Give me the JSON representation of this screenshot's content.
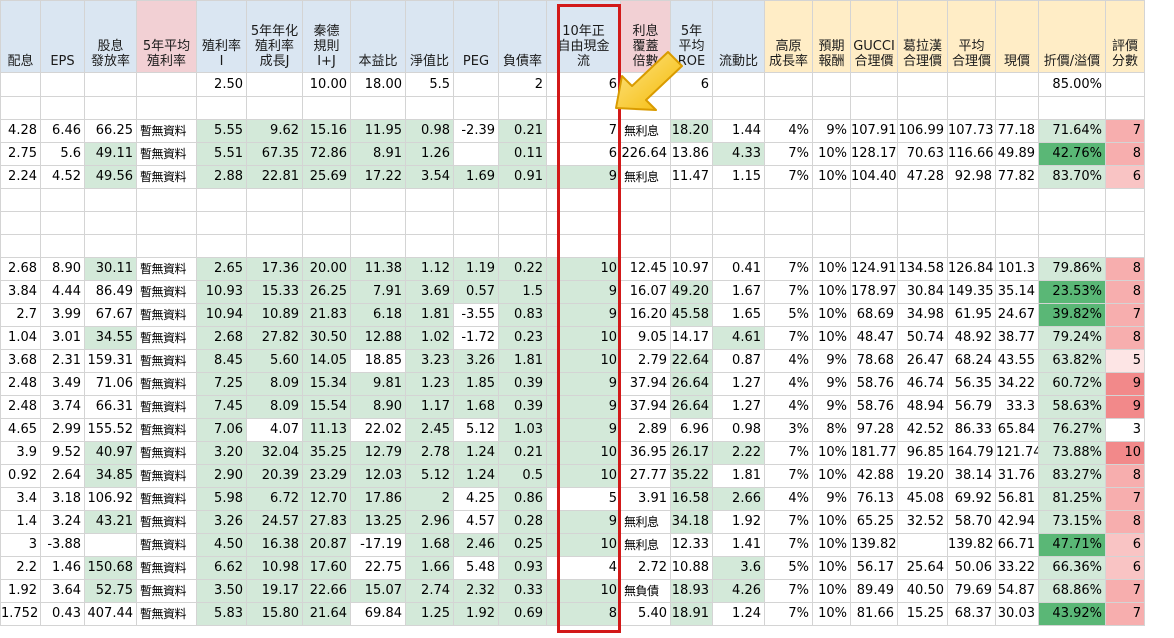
{
  "headers": [
    "配息",
    "EPS",
    "股息\n發放率",
    "5年平均\n殖利率",
    "殖利率\nI",
    "5年年化\n殖利率\n成長J",
    "秦德\n規則\nI+J",
    "本益比",
    "淨值比",
    "PEG",
    "負債率",
    "10年正\n自由現金\n流",
    "利息\n覆蓋\n倍數",
    "5年\n平均\nROE",
    "流動比",
    "高原\n成長率",
    "預期\n報酬",
    "GUCCI\n合理價",
    "葛拉漢\n合理價",
    "平均\n合理價",
    "現價",
    "折價/溢價",
    "評價\n分數"
  ],
  "header_color_classes": [
    "",
    "",
    "",
    "pink",
    "",
    "",
    "",
    "",
    "",
    "",
    "",
    "",
    "pink",
    "",
    "",
    "amber",
    "amber",
    "amber",
    "amber",
    "amber",
    "amber",
    "amber",
    "amber"
  ],
  "criteria_row": [
    "",
    "",
    "",
    "",
    "2.50",
    "",
    "10.00",
    "18.00",
    "5.5",
    "",
    "2",
    "6",
    "",
    "6",
    "",
    "",
    "",
    "",
    "",
    "",
    "",
    "85.00%",
    ""
  ],
  "rows": [
    {
      "type": "blank"
    },
    {
      "type": "data",
      "cells": [
        "4.28",
        "6.46",
        "66.25",
        "暫無資料",
        "5.55",
        "9.62",
        "15.16",
        "11.95",
        "0.98",
        "-2.39",
        "0.21",
        "7",
        "無利息",
        "18.20",
        "1.44",
        "4%",
        "9%",
        "107.91",
        "106.99",
        "107.73",
        "77.18",
        "71.64%",
        "7"
      ],
      "colors": [
        "",
        "",
        "",
        "",
        "g",
        "g",
        "g",
        "g",
        "g",
        "",
        "g",
        "",
        "",
        "g",
        "",
        "",
        "",
        "",
        "",
        "",
        "",
        "g",
        "r3"
      ]
    },
    {
      "type": "data",
      "cells": [
        "2.75",
        "5.6",
        "49.11",
        "暫無資料",
        "5.51",
        "67.35",
        "72.86",
        "8.91",
        "1.26",
        "",
        "0.11",
        "6",
        "226.64",
        "13.86",
        "4.33",
        "7%",
        "10%",
        "128.17",
        "70.63",
        "116.66",
        "49.89",
        "42.76%",
        "8"
      ],
      "colors": [
        "",
        "",
        "g",
        "",
        "g",
        "g",
        "g",
        "g",
        "g",
        "",
        "g",
        "",
        "",
        "",
        "g",
        "",
        "",
        "",
        "",
        "",
        "",
        "gr",
        "r3"
      ]
    },
    {
      "type": "data",
      "cells": [
        "2.24",
        "4.52",
        "49.56",
        "暫無資料",
        "2.88",
        "22.81",
        "25.69",
        "17.22",
        "3.54",
        "1.69",
        "0.91",
        "9",
        "無利息",
        "11.47",
        "1.15",
        "7%",
        "10%",
        "104.40",
        "47.28",
        "92.98",
        "77.82",
        "83.70%",
        "6"
      ],
      "colors": [
        "",
        "",
        "g",
        "",
        "g",
        "g",
        "g",
        "g",
        "g",
        "g",
        "g",
        "g",
        "",
        "",
        "",
        "",
        "",
        "",
        "",
        "",
        "",
        "g",
        "r2"
      ]
    },
    {
      "type": "blank"
    },
    {
      "type": "blank"
    },
    {
      "type": "blank"
    },
    {
      "type": "data",
      "cells": [
        "2.68",
        "8.90",
        "30.11",
        "暫無資料",
        "2.65",
        "17.36",
        "20.00",
        "11.38",
        "1.12",
        "1.19",
        "0.22",
        "10",
        "12.45",
        "10.97",
        "0.41",
        "7%",
        "10%",
        "124.91",
        "134.58",
        "126.84",
        "101.3",
        "79.86%",
        "8"
      ],
      "colors": [
        "",
        "",
        "g",
        "",
        "g",
        "g",
        "g",
        "g",
        "g",
        "g",
        "g",
        "g",
        "",
        "",
        "",
        "",
        "",
        "",
        "",
        "",
        "",
        "g",
        "r3"
      ]
    },
    {
      "type": "data",
      "cells": [
        "3.84",
        "4.44",
        "86.49",
        "暫無資料",
        "10.93",
        "15.33",
        "26.25",
        "7.91",
        "3.69",
        "0.57",
        "1.5",
        "9",
        "16.07",
        "49.20",
        "1.67",
        "7%",
        "10%",
        "178.97",
        "30.84",
        "149.35",
        "35.14",
        "23.53%",
        "8"
      ],
      "colors": [
        "",
        "",
        "",
        "",
        "g",
        "g",
        "g",
        "g",
        "g",
        "g",
        "g",
        "g",
        "",
        "g",
        "",
        "",
        "",
        "",
        "",
        "",
        "",
        "gr",
        "r3"
      ]
    },
    {
      "type": "data",
      "cells": [
        "2.7",
        "3.99",
        "67.67",
        "暫無資料",
        "10.94",
        "10.89",
        "21.83",
        "6.18",
        "1.81",
        "-3.55",
        "0.83",
        "9",
        "16.20",
        "45.58",
        "1.65",
        "5%",
        "10%",
        "68.69",
        "34.98",
        "61.95",
        "24.67",
        "39.82%",
        "7"
      ],
      "colors": [
        "",
        "",
        "",
        "",
        "g",
        "g",
        "g",
        "g",
        "g",
        "",
        "g",
        "g",
        "",
        "g",
        "",
        "",
        "",
        "",
        "",
        "",
        "",
        "gr",
        "r3"
      ]
    },
    {
      "type": "data",
      "cells": [
        "1.04",
        "3.01",
        "34.55",
        "暫無資料",
        "2.68",
        "27.82",
        "30.50",
        "12.88",
        "1.02",
        "-1.72",
        "0.23",
        "10",
        "9.05",
        "14.17",
        "4.61",
        "7%",
        "10%",
        "48.47",
        "50.74",
        "48.92",
        "38.77",
        "79.24%",
        "8"
      ],
      "colors": [
        "",
        "",
        "g",
        "",
        "g",
        "g",
        "g",
        "g",
        "g",
        "",
        "g",
        "g",
        "",
        "",
        "g",
        "",
        "",
        "",
        "",
        "",
        "",
        "g",
        "r3"
      ]
    },
    {
      "type": "data",
      "cells": [
        "3.68",
        "2.31",
        "159.31",
        "暫無資料",
        "8.45",
        "5.60",
        "14.05",
        "18.85",
        "3.23",
        "3.26",
        "1.81",
        "10",
        "2.79",
        "22.64",
        "0.87",
        "4%",
        "9%",
        "78.68",
        "26.47",
        "68.24",
        "43.55",
        "63.82%",
        "5"
      ],
      "colors": [
        "",
        "",
        "",
        "",
        "g",
        "g",
        "g",
        "",
        "g",
        "g",
        "g",
        "g",
        "",
        "g",
        "",
        "",
        "",
        "",
        "",
        "",
        "",
        "g",
        "r1"
      ]
    },
    {
      "type": "data",
      "cells": [
        "2.48",
        "3.49",
        "71.06",
        "暫無資料",
        "7.25",
        "8.09",
        "15.34",
        "9.81",
        "1.23",
        "1.85",
        "0.39",
        "9",
        "37.94",
        "26.64",
        "1.27",
        "4%",
        "9%",
        "58.76",
        "46.74",
        "56.35",
        "34.22",
        "60.72%",
        "9"
      ],
      "colors": [
        "",
        "",
        "",
        "",
        "g",
        "g",
        "g",
        "g",
        "g",
        "g",
        "g",
        "g",
        "",
        "g",
        "",
        "",
        "",
        "",
        "",
        "",
        "",
        "g",
        "r4"
      ]
    },
    {
      "type": "data",
      "cells": [
        "2.48",
        "3.74",
        "66.31",
        "暫無資料",
        "7.45",
        "8.09",
        "15.54",
        "8.90",
        "1.17",
        "1.68",
        "0.39",
        "9",
        "37.94",
        "26.64",
        "1.27",
        "4%",
        "9%",
        "58.76",
        "48.94",
        "56.79",
        "33.3",
        "58.63%",
        "9"
      ],
      "colors": [
        "",
        "",
        "",
        "",
        "g",
        "g",
        "g",
        "g",
        "g",
        "g",
        "g",
        "g",
        "",
        "g",
        "",
        "",
        "",
        "",
        "",
        "",
        "",
        "g",
        "r4"
      ]
    },
    {
      "type": "data",
      "cells": [
        "4.65",
        "2.99",
        "155.52",
        "暫無資料",
        "7.06",
        "4.07",
        "11.13",
        "22.02",
        "2.45",
        "5.12",
        "1.03",
        "9",
        "2.89",
        "6.96",
        "0.98",
        "3%",
        "8%",
        "97.28",
        "42.52",
        "86.33",
        "65.84",
        "76.27%",
        "3"
      ],
      "colors": [
        "",
        "",
        "",
        "",
        "g",
        "",
        "g",
        "",
        "g",
        "",
        "g",
        "g",
        "",
        "",
        "",
        "",
        "",
        "",
        "",
        "",
        "",
        "g",
        ""
      ]
    },
    {
      "type": "data",
      "cells": [
        "3.9",
        "9.52",
        "40.97",
        "暫無資料",
        "3.20",
        "32.04",
        "35.25",
        "12.79",
        "2.78",
        "1.24",
        "0.21",
        "10",
        "36.95",
        "26.17",
        "2.22",
        "7%",
        "10%",
        "181.77",
        "96.85",
        "164.79",
        "121.74",
        "73.88%",
        "10"
      ],
      "colors": [
        "",
        "",
        "g",
        "",
        "g",
        "g",
        "g",
        "g",
        "g",
        "g",
        "g",
        "g",
        "",
        "g",
        "g",
        "",
        "",
        "",
        "",
        "",
        "",
        "g",
        "r4"
      ]
    },
    {
      "type": "data",
      "cells": [
        "0.92",
        "2.64",
        "34.85",
        "暫無資料",
        "2.90",
        "20.39",
        "23.29",
        "12.03",
        "5.12",
        "1.24",
        "0.5",
        "10",
        "27.77",
        "35.22",
        "1.81",
        "7%",
        "10%",
        "42.88",
        "19.20",
        "38.14",
        "31.76",
        "83.27%",
        "8"
      ],
      "colors": [
        "",
        "",
        "g",
        "",
        "g",
        "g",
        "g",
        "g",
        "g",
        "g",
        "g",
        "g",
        "",
        "g",
        "",
        "",
        "",
        "",
        "",
        "",
        "",
        "g",
        "r3"
      ]
    },
    {
      "type": "data",
      "cells": [
        "3.4",
        "3.18",
        "106.92",
        "暫無資料",
        "5.98",
        "6.72",
        "12.70",
        "17.86",
        "2",
        "4.25",
        "0.86",
        "5",
        "3.91",
        "16.58",
        "2.66",
        "4%",
        "9%",
        "76.13",
        "45.08",
        "69.92",
        "56.81",
        "81.25%",
        "7"
      ],
      "colors": [
        "",
        "",
        "",
        "",
        "g",
        "g",
        "g",
        "g",
        "g",
        "",
        "g",
        "",
        "",
        "g",
        "g",
        "",
        "",
        "",
        "",
        "",
        "",
        "g",
        "r3"
      ]
    },
    {
      "type": "data",
      "cells": [
        "1.4",
        "3.24",
        "43.21",
        "暫無資料",
        "3.26",
        "24.57",
        "27.83",
        "13.25",
        "2.96",
        "4.57",
        "0.28",
        "9",
        "無利息",
        "34.18",
        "1.92",
        "7%",
        "10%",
        "65.25",
        "32.52",
        "58.70",
        "42.94",
        "73.15%",
        "8"
      ],
      "colors": [
        "",
        "",
        "g",
        "",
        "g",
        "g",
        "g",
        "g",
        "g",
        "",
        "g",
        "g",
        "",
        "g",
        "",
        "",
        "",
        "",
        "",
        "",
        "",
        "g",
        "r3"
      ]
    },
    {
      "type": "data",
      "cells": [
        "3",
        "-3.88",
        "",
        "暫無資料",
        "4.50",
        "16.38",
        "20.87",
        "-17.19",
        "1.68",
        "2.46",
        "0.25",
        "10",
        "無利息",
        "12.33",
        "1.41",
        "7%",
        "10%",
        "139.82",
        "",
        "139.82",
        "66.71",
        "47.71%",
        "6"
      ],
      "colors": [
        "",
        "",
        "",
        "",
        "g",
        "g",
        "g",
        "",
        "g",
        "g",
        "g",
        "g",
        "",
        "",
        "",
        "",
        "",
        "",
        "",
        "",
        "",
        "gr",
        "r2"
      ]
    },
    {
      "type": "data",
      "cells": [
        "2.2",
        "1.46",
        "150.68",
        "暫無資料",
        "6.62",
        "10.98",
        "17.60",
        "22.75",
        "1.66",
        "5.48",
        "0.93",
        "4",
        "2.72",
        "10.88",
        "3.6",
        "5%",
        "10%",
        "56.17",
        "25.64",
        "50.06",
        "33.22",
        "66.36%",
        "6"
      ],
      "colors": [
        "",
        "",
        "g",
        "",
        "g",
        "g",
        "g",
        "",
        "g",
        "",
        "g",
        "",
        "",
        "",
        "g",
        "",
        "",
        "",
        "",
        "",
        "",
        "g",
        "r2"
      ]
    },
    {
      "type": "data",
      "cells": [
        "1.92",
        "3.64",
        "52.75",
        "暫無資料",
        "3.50",
        "19.17",
        "22.66",
        "15.07",
        "2.74",
        "2.32",
        "0.33",
        "10",
        "無負債",
        "18.93",
        "4.26",
        "7%",
        "10%",
        "89.49",
        "40.50",
        "79.69",
        "54.87",
        "68.86%",
        "7"
      ],
      "colors": [
        "",
        "",
        "g",
        "",
        "g",
        "g",
        "g",
        "g",
        "g",
        "g",
        "g",
        "g",
        "",
        "g",
        "g",
        "",
        "",
        "",
        "",
        "",
        "",
        "g",
        "r3"
      ]
    },
    {
      "type": "data",
      "cells": [
        "1.752",
        "0.43",
        "407.44",
        "暫無資料",
        "5.83",
        "15.80",
        "21.64",
        "69.84",
        "1.25",
        "1.92",
        "0.69",
        "8",
        "5.40",
        "18.91",
        "1.24",
        "7%",
        "10%",
        "81.66",
        "15.25",
        "68.37",
        "30.03",
        "43.92%",
        "7"
      ],
      "colors": [
        "",
        "",
        "",
        "",
        "g",
        "g",
        "g",
        "",
        "g",
        "g",
        "g",
        "g",
        "",
        "g",
        "",
        "",
        "",
        "",
        "",
        "",
        "",
        "gr",
        "r3"
      ]
    }
  ],
  "annotations": {
    "highlight_color": "#d21919",
    "arrow_color": "#f5c518",
    "arrow_icon": "arrow-pointing-down-left-icon"
  }
}
